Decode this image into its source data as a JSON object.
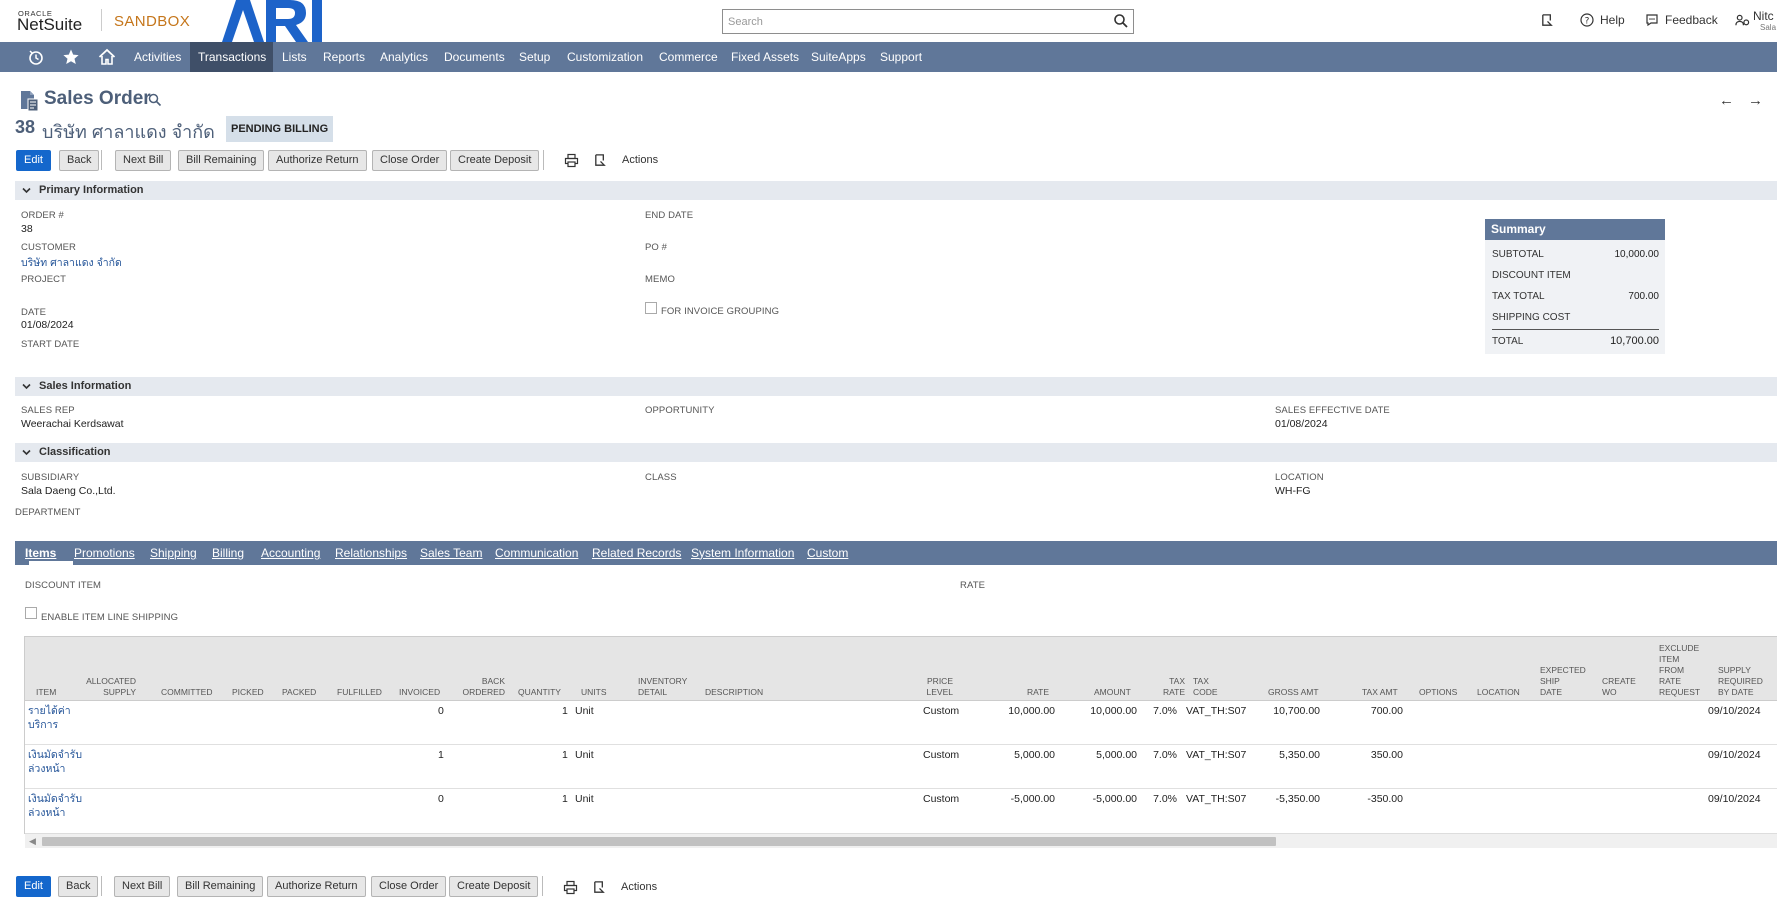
{
  "header": {
    "oracle": "ORACLE",
    "netsuite": "NetSuite",
    "sandbox": "SANDBOX",
    "search_placeholder": "Search",
    "help": "Help",
    "feedback": "Feedback",
    "user_name": "Nitc",
    "user_sub": "Sala D"
  },
  "nav": {
    "items": [
      "Activities",
      "Transactions",
      "Lists",
      "Reports",
      "Analytics",
      "Documents",
      "Setup",
      "Customization",
      "Commerce",
      "Fixed Assets",
      "SuiteApps",
      "Support"
    ],
    "active": "Transactions"
  },
  "record": {
    "type": "Sales Order",
    "number": "38",
    "name": "บริษัท ศาลาแดง จำกัด",
    "status": "PENDING BILLING"
  },
  "buttons": {
    "edit": "Edit",
    "back": "Back",
    "next_bill": "Next Bill",
    "bill_remaining": "Bill Remaining",
    "authorize_return": "Authorize Return",
    "close_order": "Close Order",
    "create_deposit": "Create Deposit",
    "actions": "Actions"
  },
  "sections": {
    "primary": "Primary Information",
    "sales": "Sales Information",
    "classification": "Classification"
  },
  "primary": {
    "order_label": "ORDER #",
    "order_value": "38",
    "customer_label": "CUSTOMER",
    "customer_value": "บริษัท ศาลาแดง จำกัด",
    "project_label": "PROJECT",
    "date_label": "DATE",
    "date_value": "01/08/2024",
    "start_date_label": "START DATE",
    "end_date_label": "END DATE",
    "po_label": "PO #",
    "memo_label": "MEMO",
    "invoice_grouping_label": "FOR INVOICE GROUPING"
  },
  "summary": {
    "title": "Summary",
    "subtotal_label": "SUBTOTAL",
    "subtotal": "10,000.00",
    "discount_label": "DISCOUNT ITEM",
    "tax_label": "TAX TOTAL",
    "tax": "700.00",
    "shipping_label": "SHIPPING COST",
    "total_label": "TOTAL",
    "total": "10,700.00"
  },
  "sales": {
    "rep_label": "SALES REP",
    "rep_value": "Weerachai Kerdsawat",
    "opportunity_label": "OPPORTUNITY",
    "effective_label": "SALES EFFECTIVE DATE",
    "effective_value": "01/08/2024"
  },
  "classification": {
    "subsidiary_label": "SUBSIDIARY",
    "subsidiary_value": "Sala Daeng Co.,Ltd.",
    "class_label": "CLASS",
    "location_label": "LOCATION",
    "location_value": "WH-FG",
    "department_label": "DEPARTMENT"
  },
  "tabs": [
    "Items",
    "Promotions",
    "Shipping",
    "Billing",
    "Accounting",
    "Relationships",
    "Sales Team",
    "Communication",
    "Related Records",
    "System Information",
    "Custom"
  ],
  "items_tab": {
    "discount_item_label": "DISCOUNT ITEM",
    "rate_label": "RATE",
    "enable_line_shipping": "ENABLE ITEM LINE SHIPPING"
  },
  "table": {
    "headers": {
      "item": "ITEM",
      "allocated_supply": "ALLOCATED SUPPLY",
      "committed": "COMMITTED",
      "picked": "PICKED",
      "packed": "PACKED",
      "fulfilled": "FULFILLED",
      "invoiced": "INVOICED",
      "back_ordered": "BACK ORDERED",
      "quantity": "QUANTITY",
      "units": "UNITS",
      "inventory_detail": "INVENTORY DETAIL",
      "description": "DESCRIPTION",
      "price_level": "PRICE LEVEL",
      "rate": "RATE",
      "amount": "AMOUNT",
      "tax_rate": "TAX RATE",
      "tax_code": "TAX CODE",
      "gross_amt": "GROSS AMT",
      "tax_amt": "TAX AMT",
      "options": "OPTIONS",
      "location": "LOCATION",
      "expected_ship_date": "EXPECTED SHIP DATE",
      "create_wo": "CREATE WO",
      "exclude_item": "EXCLUDE ITEM FROM RATE REQUEST",
      "supply_required": "SUPPLY REQUIRED BY DATE"
    },
    "rows": [
      {
        "item": "รายได้ค่าบริการ",
        "invoiced": "0",
        "quantity": "1",
        "units": "Unit",
        "price_level": "Custom",
        "rate": "10,000.00",
        "amount": "10,000.00",
        "tax_rate": "7.0%",
        "tax_code": "VAT_TH:S07",
        "gross_amt": "10,700.00",
        "tax_amt": "700.00",
        "supply_date": "09/10/2024"
      },
      {
        "item": "เงินมัดจำรับล่วงหน้า",
        "invoiced": "1",
        "quantity": "1",
        "units": "Unit",
        "price_level": "Custom",
        "rate": "5,000.00",
        "amount": "5,000.00",
        "tax_rate": "7.0%",
        "tax_code": "VAT_TH:S07",
        "gross_amt": "5,350.00",
        "tax_amt": "350.00",
        "supply_date": "09/10/2024"
      },
      {
        "item": "เงินมัดจำรับล่วงหน้า",
        "invoiced": "0",
        "quantity": "1",
        "units": "Unit",
        "price_level": "Custom",
        "rate": "-5,000.00",
        "amount": "-5,000.00",
        "tax_rate": "7.0%",
        "tax_code": "VAT_TH:S07",
        "gross_amt": "-5,350.00",
        "tax_amt": "-350.00",
        "supply_date": "09/10/2024"
      }
    ]
  },
  "colors": {
    "navbar": "#607799",
    "nav_active": "#3f4f68",
    "primary_button": "#1467cc",
    "sandbox": "#c5761b",
    "link": "#255599",
    "ari_logo": "#1d63c9"
  },
  "icons": [
    "recent-records-icon",
    "star-icon",
    "home-icon",
    "search-icon",
    "notifications-icon",
    "help-icon",
    "feedback-icon",
    "roles-icon",
    "sales-order-icon",
    "print-icon",
    "recent-action-icon",
    "chevron-down-icon",
    "arrow-left-icon",
    "arrow-right-icon"
  ]
}
